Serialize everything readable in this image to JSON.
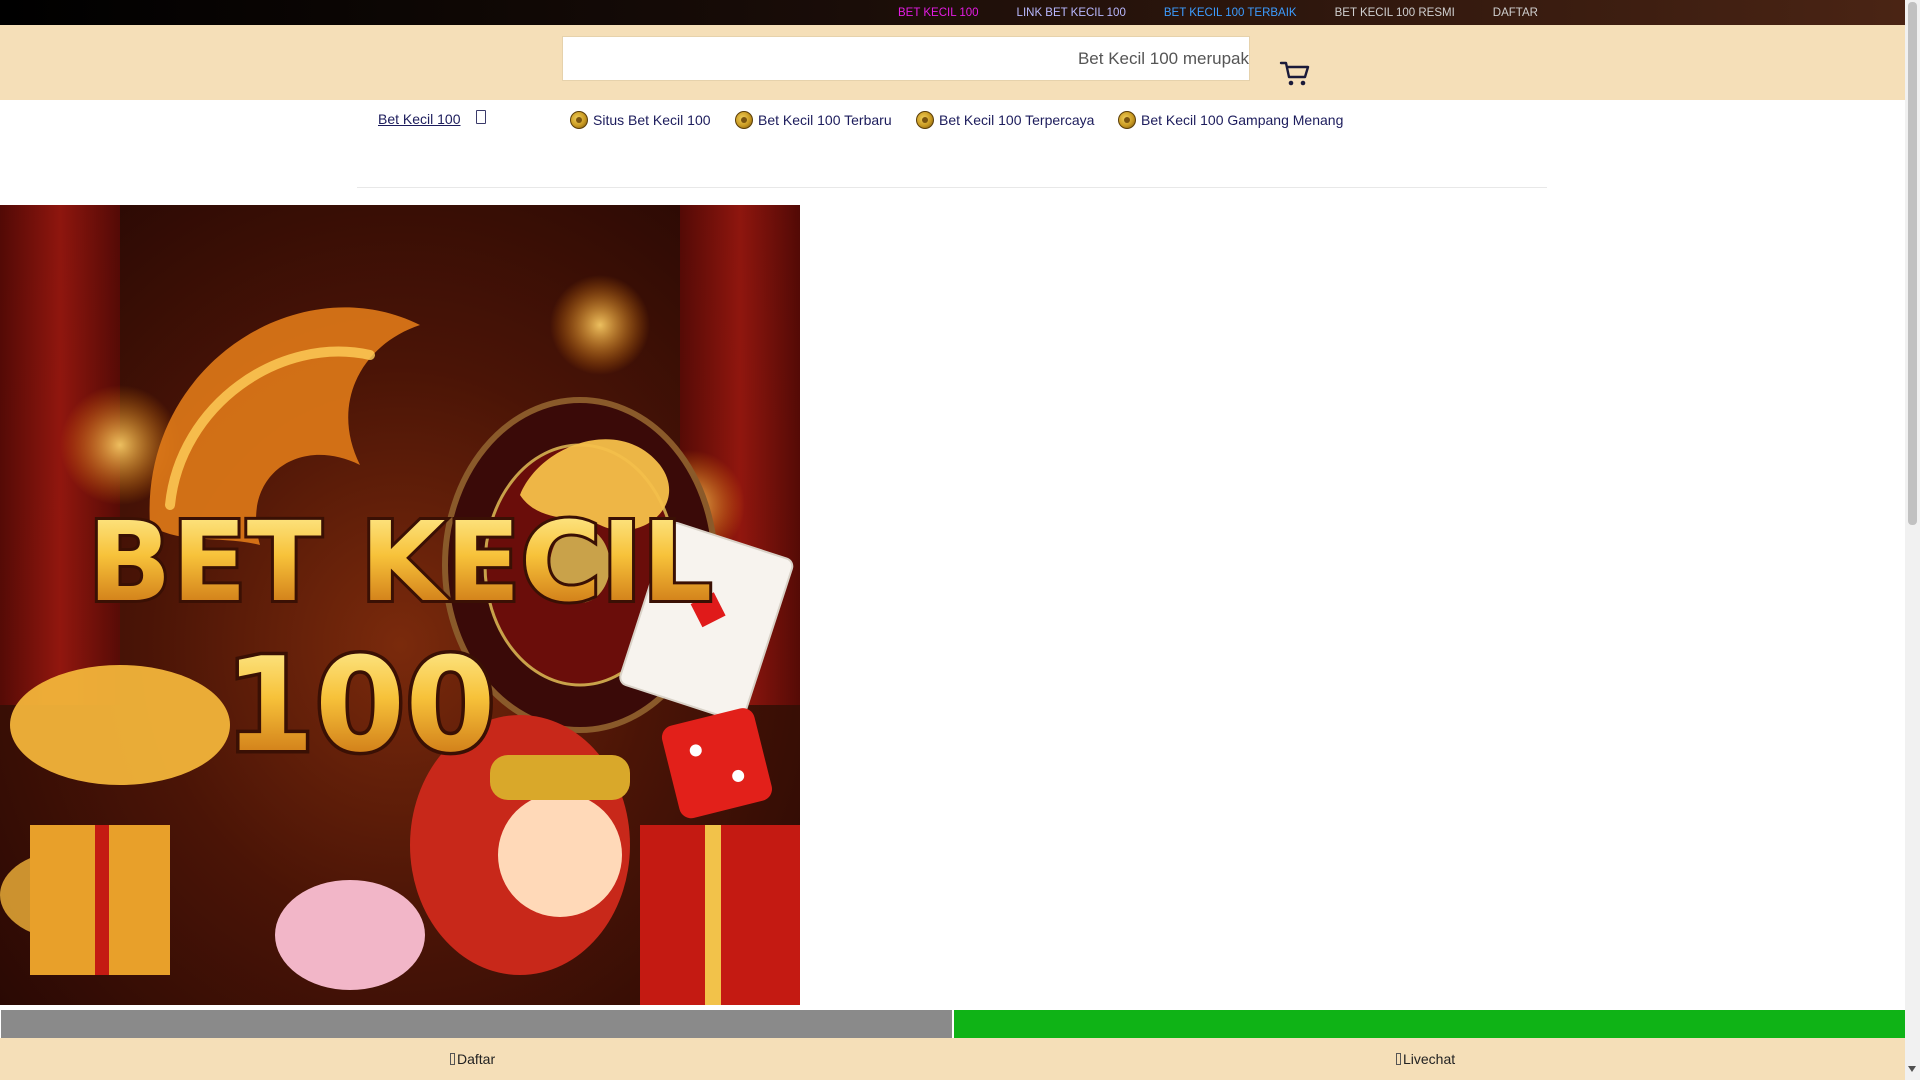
{
  "top_links": [
    {
      "label": "BET KECIL 100",
      "color": "#e31ce3"
    },
    {
      "label": "LINK BET KECIL 100",
      "color": "#b9b9ff"
    },
    {
      "label": "BET KECIL 100 TERBAIK",
      "color": "#3c9cff"
    },
    {
      "label": "BET KECIL 100 RESMI",
      "color": "#cfcfcf"
    },
    {
      "label": "DAFTAR",
      "color": "#cfcfcf"
    }
  ],
  "search": {
    "text": "Bet Kecil 100 merupak"
  },
  "nav": {
    "home_label": "Bet Kecil 100",
    "items": [
      {
        "label": "Situs Bet Kecil 100"
      },
      {
        "label": "Bet Kecil 100 Terbaru"
      },
      {
        "label": "Bet Kecil 100 Terpercaya"
      },
      {
        "label": "Bet Kecil 100 Gampang Menang"
      }
    ]
  },
  "hero": {
    "title_line1": "BET KECIL",
    "title_line2": "100"
  },
  "footer": {
    "daftar_label": "Daftar",
    "livechat_label": "Livechat"
  },
  "colors": {
    "header_bg": "#f5dfb8",
    "accent_green": "#0fb316",
    "bar_gray": "#8a8a8a",
    "nav_text": "#1c1c5c"
  }
}
